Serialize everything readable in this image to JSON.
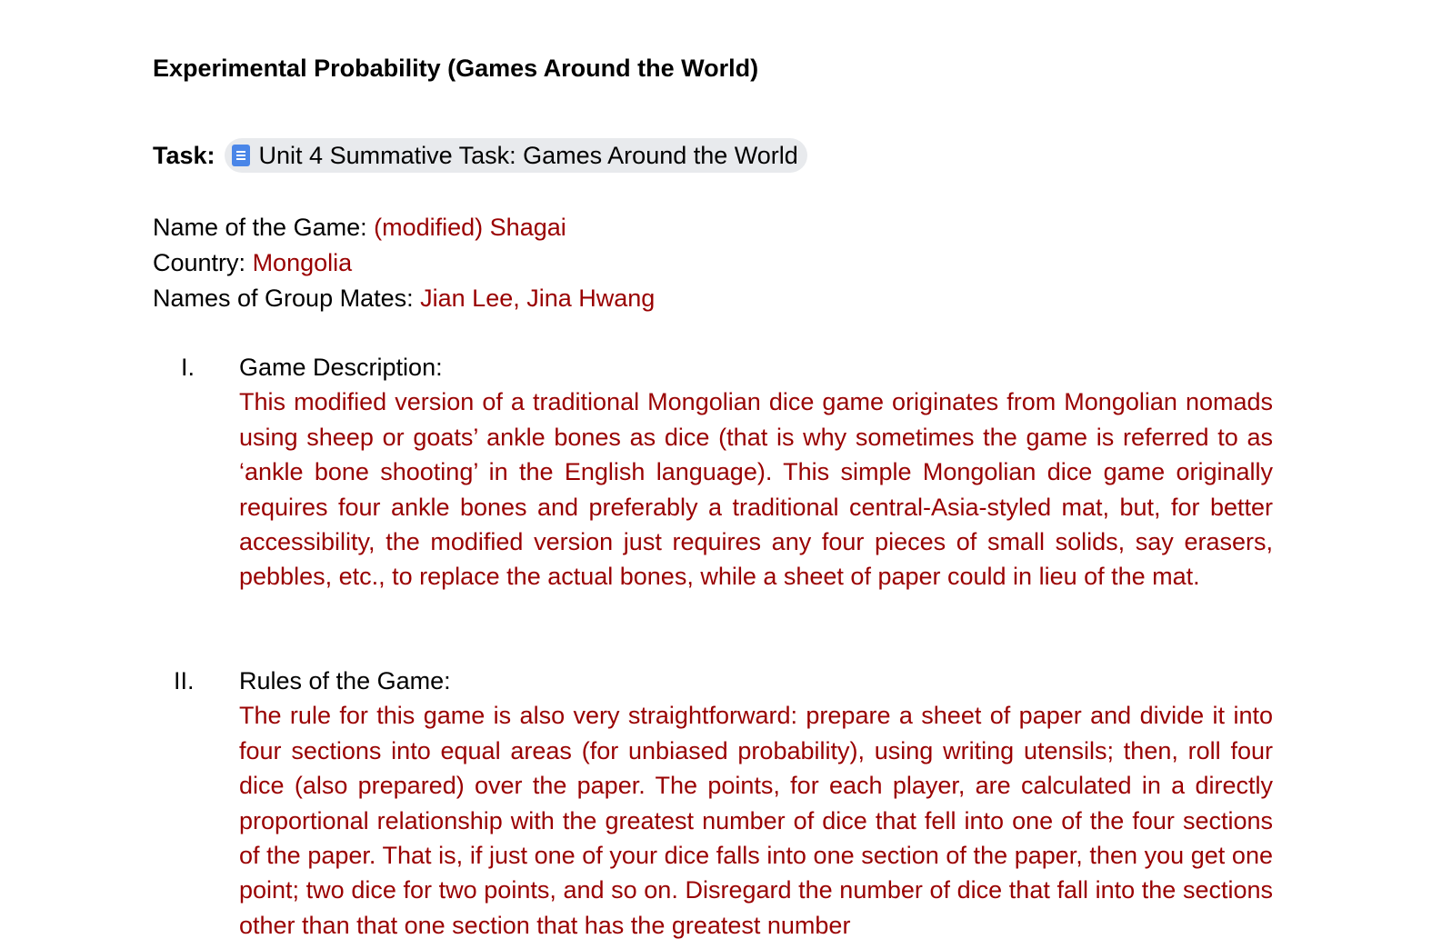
{
  "document": {
    "title": "Experimental Probability (Games Around the World)",
    "task": {
      "label": "Task:",
      "chip_icon": "google-docs-icon",
      "chip_text": "Unit 4 Summative Task: Games Around the World"
    },
    "meta": {
      "game_label": "Name of the Game:",
      "game_value": "(modified) Shagai",
      "country_label": "Country:",
      "country_value": "Mongolia",
      "group_label": "Names of Group Mates:",
      "group_value": "Jian Lee, Jina Hwang"
    },
    "sections": [
      {
        "numeral": "I.",
        "heading": "Game Description:",
        "body": "This modified version of a traditional Mongolian dice game originates from Mongolian nomads using sheep or goats’ ankle bones as dice (that is why sometimes the game is referred to as ‘ankle bone shooting’ in the English language). This simple Mongolian dice game originally requires four ankle bones and preferably a traditional central-Asia-styled mat, but, for better accessibility, the modified version just requires any four pieces of small solids, say erasers, pebbles, etc., to replace the actual bones, while a sheet of paper could in lieu of the mat."
      },
      {
        "numeral": "II.",
        "heading": "Rules of the Game:",
        "body": "The rule for this game is also very straightforward: prepare a sheet of paper and divide it into four sections into equal areas (for unbiased probability), using writing utensils; then, roll four dice (also prepared) over the paper. The points, for each player, are calculated in a directly proportional relationship with the greatest number of dice that fell into one of the four sections of the paper. That is, if just one of your dice falls into one section of the paper, then you get one point; two dice for two points, and so on. Disregard the number of dice that fall into the sections other than that one section that has the greatest number"
      }
    ],
    "colors": {
      "answer_text": "#990000",
      "chip_background": "#e8eaed",
      "doc_icon": "#4a86e8"
    }
  }
}
